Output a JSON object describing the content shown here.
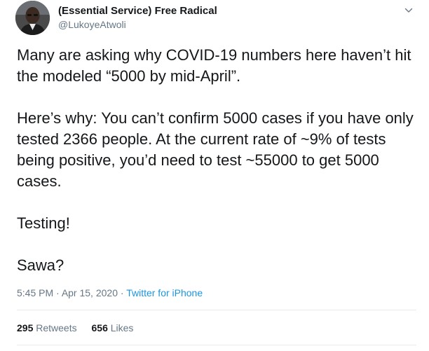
{
  "author": {
    "display_name": "(Essential Service) Free Radical",
    "handle": "@LukoyeAtwoli",
    "avatar_icon": "user-avatar"
  },
  "tweet": {
    "paragraphs": [
      "Many are asking why COVID-19 numbers here haven’t hit the modeled “5000 by mid-April”.",
      "Here’s why: You can’t confirm 5000 cases if you have only tested 2366 people. At the current rate of ~9% of tests being positive, you’d need to test ~55000 to get 5000 cases.",
      "Testing!",
      "Sawa?"
    ]
  },
  "meta": {
    "time": "5:45 PM",
    "separator": " · ",
    "date": "Apr 15, 2020",
    "source": "Twitter for iPhone"
  },
  "stats": {
    "retweets_count": "295",
    "retweets_label": "Retweets",
    "likes_count": "656",
    "likes_label": "Likes"
  },
  "colors": {
    "text": "#14171a",
    "secondary": "#657786",
    "link": "#1b95e0",
    "divider": "#e6ecf0"
  },
  "icons": {
    "menu": "chevron-down-icon"
  }
}
